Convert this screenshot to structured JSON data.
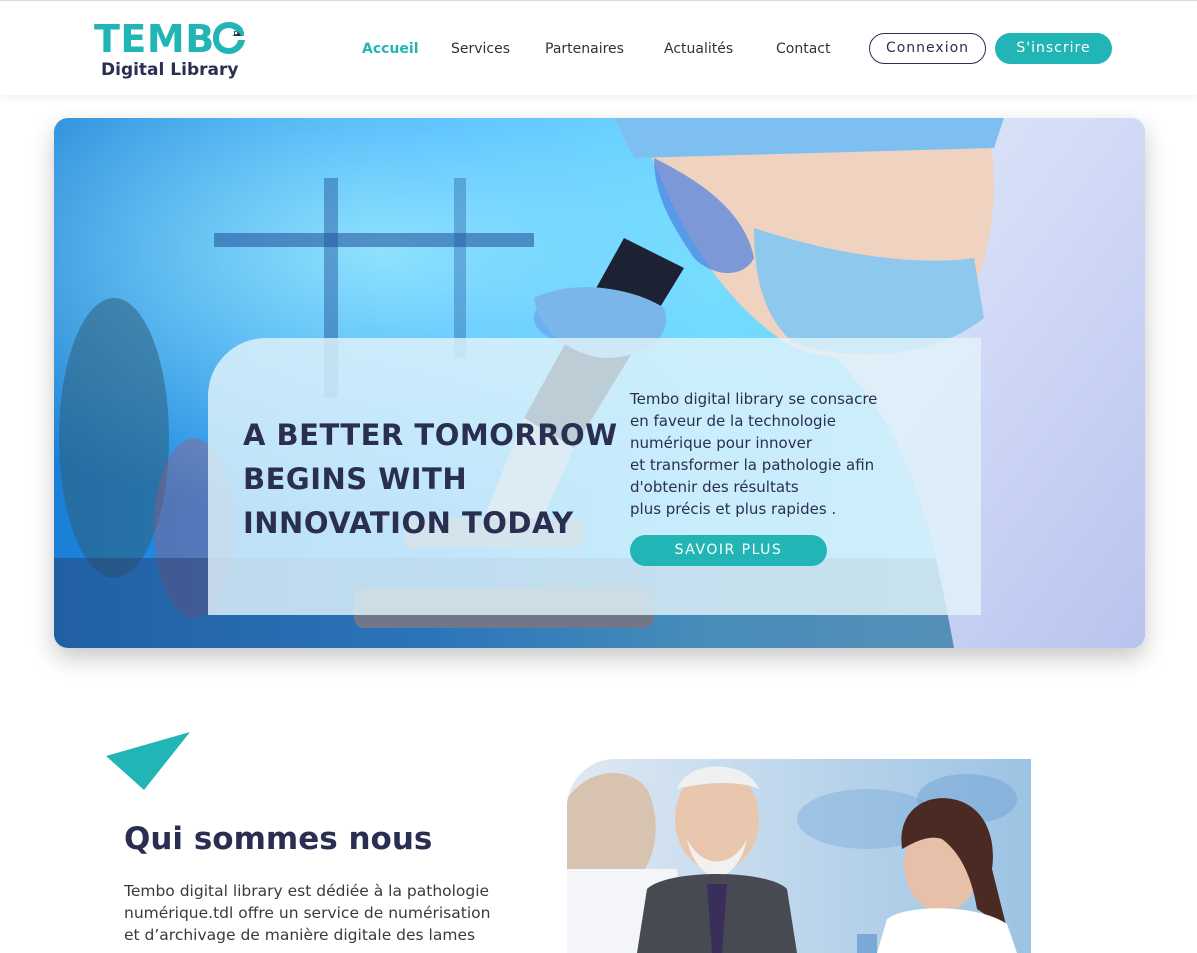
{
  "logo": {
    "word": "TEMB",
    "subtitle": "Digital Library",
    "mark": "tembo-elephant-mark"
  },
  "nav": {
    "items": [
      {
        "label": "Accueil",
        "active": true
      },
      {
        "label": "Services",
        "active": false
      },
      {
        "label": "Partenaires",
        "active": false
      },
      {
        "label": "Actualités",
        "active": false
      },
      {
        "label": "Contact",
        "active": false
      }
    ],
    "login_label": "Connexion",
    "signup_label": "S'inscrire"
  },
  "hero": {
    "title_lines": [
      "A BETTER TOMORROW",
      "BEGINS WITH",
      "INNOVATION TODAY"
    ],
    "text_lines": [
      "Tembo digital library se consacre",
      "en faveur de la technologie",
      "numérique pour innover",
      "et transformer la pathologie afin",
      "d'obtenir des résultats",
      "plus précis et plus rapides ."
    ],
    "button_label": "SAVOIR PLUS",
    "image": "scientist-with-microscope-photo"
  },
  "about": {
    "title": "Qui sommes nous",
    "text_lines": [
      "Tembo digital library est dédiée à la pathologie",
      "numérique.tdl offre un service de numérisation",
      "et d’archivage de manière digitale des lames"
    ],
    "image": "doctors-conversation-photo"
  },
  "colors": {
    "accent": "#22b5b5",
    "navy": "#2a2f52"
  }
}
